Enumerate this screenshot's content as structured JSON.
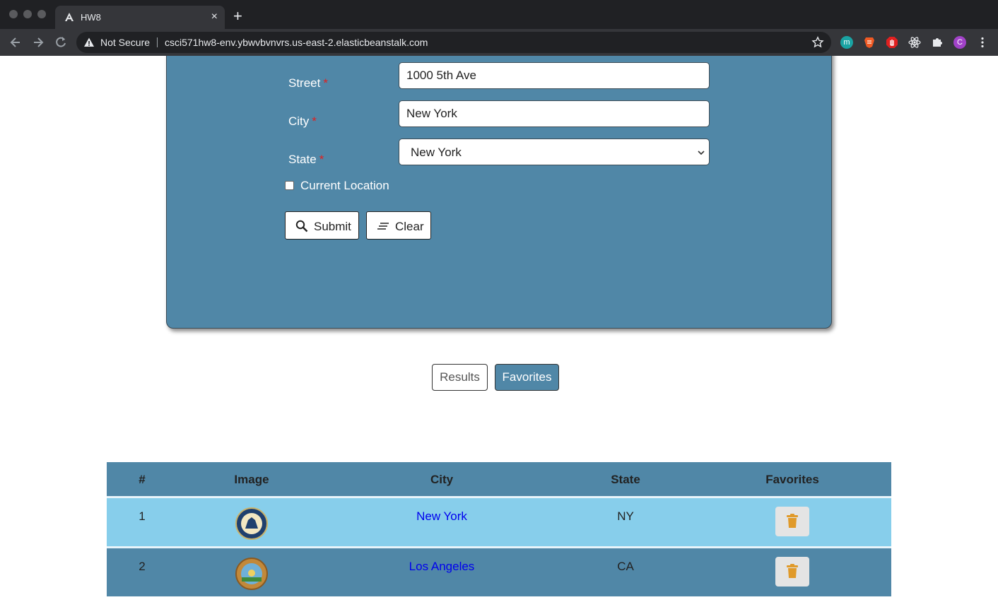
{
  "browser": {
    "tab_title": "HW8",
    "tab_close": "×",
    "new_tab": "+",
    "security_label": "Not Secure",
    "url": "csci571hw8-env.ybwvbvnvrs.us-east-2.elasticbeanstalk.com",
    "profile_initial": "C",
    "extension_m": "m"
  },
  "form": {
    "street_label": "Street",
    "street_value": "1000 5th Ave",
    "city_label": "City",
    "city_value": "New York",
    "state_label": "State",
    "state_value": "New York",
    "required_mark": "*",
    "current_location_label": "Current Location",
    "submit_label": "Submit",
    "clear_label": "Clear"
  },
  "toggles": {
    "results_label": "Results",
    "favorites_label": "Favorites"
  },
  "favorites_table": {
    "headers": [
      "#",
      "Image",
      "City",
      "State",
      "Favorites"
    ],
    "rows": [
      {
        "index": "1",
        "city": "New York",
        "state": "NY",
        "seal_color": "#1f3f6e",
        "row_color": "#87ceeb"
      },
      {
        "index": "2",
        "city": "Los Angeles",
        "state": "CA",
        "seal_color": "#c2893a",
        "row_color": "#5087a7"
      }
    ]
  },
  "colors": {
    "card": "#5087a7",
    "trash": "#e09a2a",
    "link": "#0000ee"
  }
}
